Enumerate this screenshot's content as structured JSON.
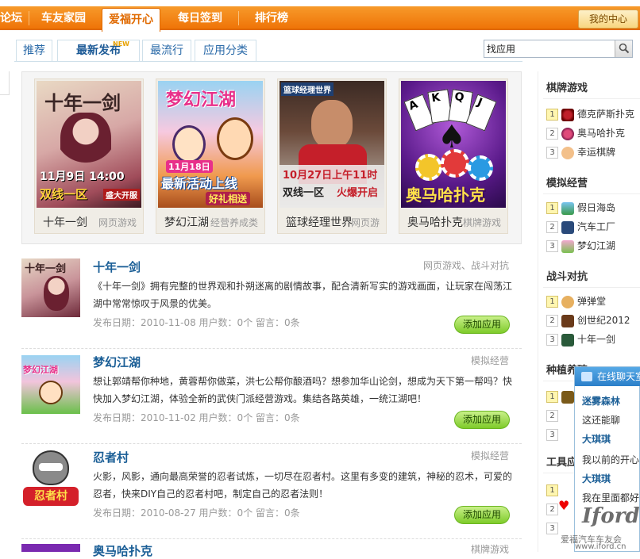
{
  "nav": {
    "items": [
      "论坛",
      "车友家园",
      "爱福开心",
      "每日签到",
      "排行榜"
    ],
    "active": "爱福开心",
    "my_center": "我的中心"
  },
  "tabs": [
    "推荐",
    "最新发布",
    "最流行",
    "应用分类"
  ],
  "new_badge": "NEW",
  "search": {
    "value": "找应用",
    "icon": "search-icon"
  },
  "featured": [
    {
      "name": "十年一剑",
      "category": "网页游戏",
      "poster_text": [
        "十年一剑",
        "11月9日 14:00",
        "双线一区",
        "盛大开服"
      ]
    },
    {
      "name": "梦幻江湖",
      "category": "经营养成类",
      "poster_text": [
        "梦幻江湖",
        "11月18日",
        "最新活动上线",
        "好礼相送"
      ]
    },
    {
      "name": "篮球经理世界",
      "category": "网页游",
      "poster_text": [
        "篮球经理世界",
        "10月27日上午11时",
        "双线一区",
        "火爆开启"
      ]
    },
    {
      "name": "奥马哈扑克",
      "category": "棋牌游戏",
      "poster_text": [
        "A",
        "K",
        "Q",
        "J",
        "奥马哈扑克"
      ]
    }
  ],
  "list": [
    {
      "title": "十年一剑",
      "category": "网页游戏、战斗对抗",
      "desc": "《十年一剑》拥有完整的世界观和扑朔迷离的剧情故事，配合清新写实的游戏画面，让玩家在闯荡江湖中常常惊叹于风景的优美。",
      "meta": "发布日期：2010-11-08 用户数：0个  留言：0条",
      "button": "添加应用"
    },
    {
      "title": "梦幻江湖",
      "category": "模拟经营",
      "desc": "想让郭靖帮你种地，黄蓉帮你做菜，洪七公帮你酿酒吗？想参加华山论剑，想成为天下第一帮吗？快快加入梦幻江湖，体验全新的武侠门派经营游戏。集结各路英雄，一统江湖吧！",
      "meta": "发布日期：2010-11-02 用户数：0个  留言：0条",
      "button": "添加应用"
    },
    {
      "title": "忍者村",
      "category": "模拟经营",
      "desc": "火影，风影，通向最高荣誉的忍者试炼，一切尽在忍者村。这里有多变的建筑，神秘的忍术，可爱的忍者，快来DIY自己的忍者村吧，制定自己的忍者法则！",
      "meta": "发布日期：2010-08-27 用户数：0个  留言：0条",
      "button": "添加应用",
      "thumb_text": "忍者村"
    },
    {
      "title": "奥马哈扑克",
      "category": "棋牌游戏"
    }
  ],
  "sidebar": {
    "sections": [
      {
        "title": "棋牌游戏",
        "items": [
          {
            "rank": "1",
            "name": "德克萨斯扑克"
          },
          {
            "rank": "2",
            "name": "奥马哈扑克"
          },
          {
            "rank": "3",
            "name": "幸运棋牌"
          }
        ]
      },
      {
        "title": "模拟经营",
        "items": [
          {
            "rank": "1",
            "name": "假日海岛"
          },
          {
            "rank": "2",
            "name": "汽车工厂"
          },
          {
            "rank": "3",
            "name": "梦幻江湖"
          }
        ]
      },
      {
        "title": "战斗对抗",
        "items": [
          {
            "rank": "1",
            "name": "弹弹堂"
          },
          {
            "rank": "2",
            "name": "创世纪2012"
          },
          {
            "rank": "3",
            "name": "十年一剑"
          }
        ]
      },
      {
        "title": "种植养殖",
        "items": [
          {
            "rank": "1",
            "name": ""
          },
          {
            "rank": "2",
            "name": ""
          },
          {
            "rank": "3",
            "name": ""
          }
        ]
      },
      {
        "title": "工具应用",
        "items": [
          {
            "rank": "1",
            "name": ""
          },
          {
            "rank": "2",
            "name": ""
          },
          {
            "rank": "3",
            "name": ""
          }
        ]
      }
    ]
  },
  "chat": {
    "header": "在线聊天室",
    "lines": [
      {
        "text": "迷雾森林",
        "bold": true
      },
      {
        "text": "这还能聊",
        "bold": false
      },
      {
        "text": "大琪琪",
        "bold": true
      },
      {
        "text": "我以前的开心",
        "bold": false
      },
      {
        "text": "大琪琪",
        "bold": true
      },
      {
        "text": "我在里面都好",
        "bold": false
      }
    ]
  },
  "watermark": {
    "logo": "Iford",
    "text": "爱福汽车车友会",
    "url": "www.iford.cn"
  },
  "colors": {
    "nav_orange": "#ef7408",
    "link_blue": "#1a5e96",
    "button_green": "#7ecb2a",
    "chat_blue": "#2b7fc9"
  }
}
